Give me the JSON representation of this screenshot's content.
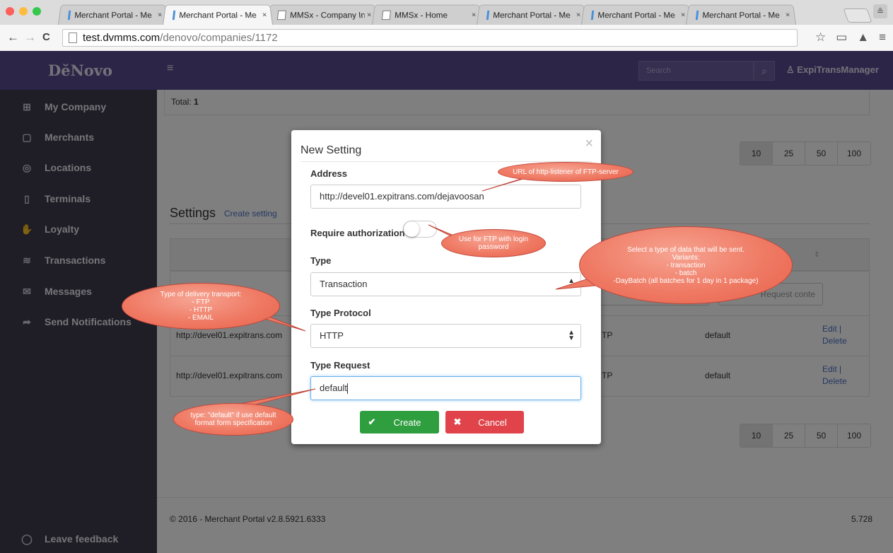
{
  "browser": {
    "tabs": [
      {
        "title": "Merchant Portal - Me",
        "active": false
      },
      {
        "title": "Merchant Portal - Me",
        "active": true
      },
      {
        "title": "MMSx - Company Inf",
        "active": false
      },
      {
        "title": "MMSx - Home",
        "active": false
      },
      {
        "title": "Merchant Portal - Me",
        "active": false
      },
      {
        "title": "Merchant Portal - Me",
        "active": false
      },
      {
        "title": "Merchant Portal - Me",
        "active": false
      }
    ],
    "tab_close": "×",
    "url_host": "test.dvmms.com",
    "url_path": "/denovo/companies/1172",
    "back": "←",
    "forward": "→",
    "reload": "C",
    "star": "☆",
    "cast": "▭",
    "drive": "▲",
    "menu": "≡",
    "profile": "≗"
  },
  "header": {
    "brand": "DĕNovo",
    "menu_icon": "≡",
    "search_placeholder": "Search",
    "search_icon": "⌕",
    "user": "ExpiTransManager",
    "user_icon": "♙"
  },
  "sidebar": {
    "items": [
      {
        "label": "My Company",
        "icon": "⊞"
      },
      {
        "label": "Merchants",
        "icon": "▢"
      },
      {
        "label": "Locations",
        "icon": "◎"
      },
      {
        "label": "Terminals",
        "icon": "▯"
      },
      {
        "label": "Loyalty",
        "icon": "✋"
      },
      {
        "label": "Transactions",
        "icon": "≋"
      },
      {
        "label": "Messages",
        "icon": "✉"
      },
      {
        "label": "Send Notifications",
        "icon": "➦"
      }
    ],
    "feedback": {
      "label": "Leave feedback",
      "icon": "◯"
    }
  },
  "main": {
    "total_label": "Total:",
    "total_value": "1",
    "page_sizes": [
      "10",
      "25",
      "50",
      "100"
    ],
    "active_page_size": "10",
    "settings_title": "Settings",
    "create_setting_link": "Create setting",
    "filter_suffix": "l",
    "filter_request": "Request conte",
    "rows": [
      {
        "address": "http://devel01.expitrans.com",
        "protocol": "TP",
        "request": "default",
        "edit": "Edit",
        "delete": "Delete"
      },
      {
        "address": "http://devel01.expitrans.com",
        "protocol": "TP",
        "request": "default",
        "edit": "Edit",
        "delete": "Delete"
      }
    ],
    "footer": "© 2016 - Merchant Portal v2.8.5921.6333",
    "footer_right": "5.728"
  },
  "modal": {
    "title": "New Setting",
    "close": "×",
    "address_label": "Address",
    "address_value": "http://devel01.expitrans.com/dejavoosan",
    "auth_label": "Require authorization",
    "auth_enabled": false,
    "type_label": "Type",
    "type_value": "Transaction",
    "protocol_label": "Type Protocol",
    "protocol_value": "HTTP",
    "request_label": "Type Request",
    "request_value": "default",
    "create_label": "Create",
    "create_icon": "✔",
    "cancel_label": "Cancel",
    "cancel_icon": "✖"
  },
  "annotations": {
    "url": "URL of http-listener of FTP-server",
    "auth_1": "Use for FTP with login",
    "auth_2": "password",
    "type_1": "Select a type of data that will be sent.",
    "type_2": "Variants:",
    "type_3": "- transaction",
    "type_4": "- batch",
    "type_5": "-DayBatch (all batches for 1 day in 1 package)",
    "transport_1": "Type of delivery transport:",
    "transport_2": "- FTP",
    "transport_3": "- HTTP",
    "transport_4": "- EMAIL",
    "request_1": "type: \"default\" if use default",
    "request_2": "format form specification"
  },
  "colors": {
    "header": "#5a4a8f",
    "sidebar": "#3e3a4c",
    "create": "#2e9e3e",
    "cancel": "#e0434a",
    "callout": "#ef7a64"
  }
}
